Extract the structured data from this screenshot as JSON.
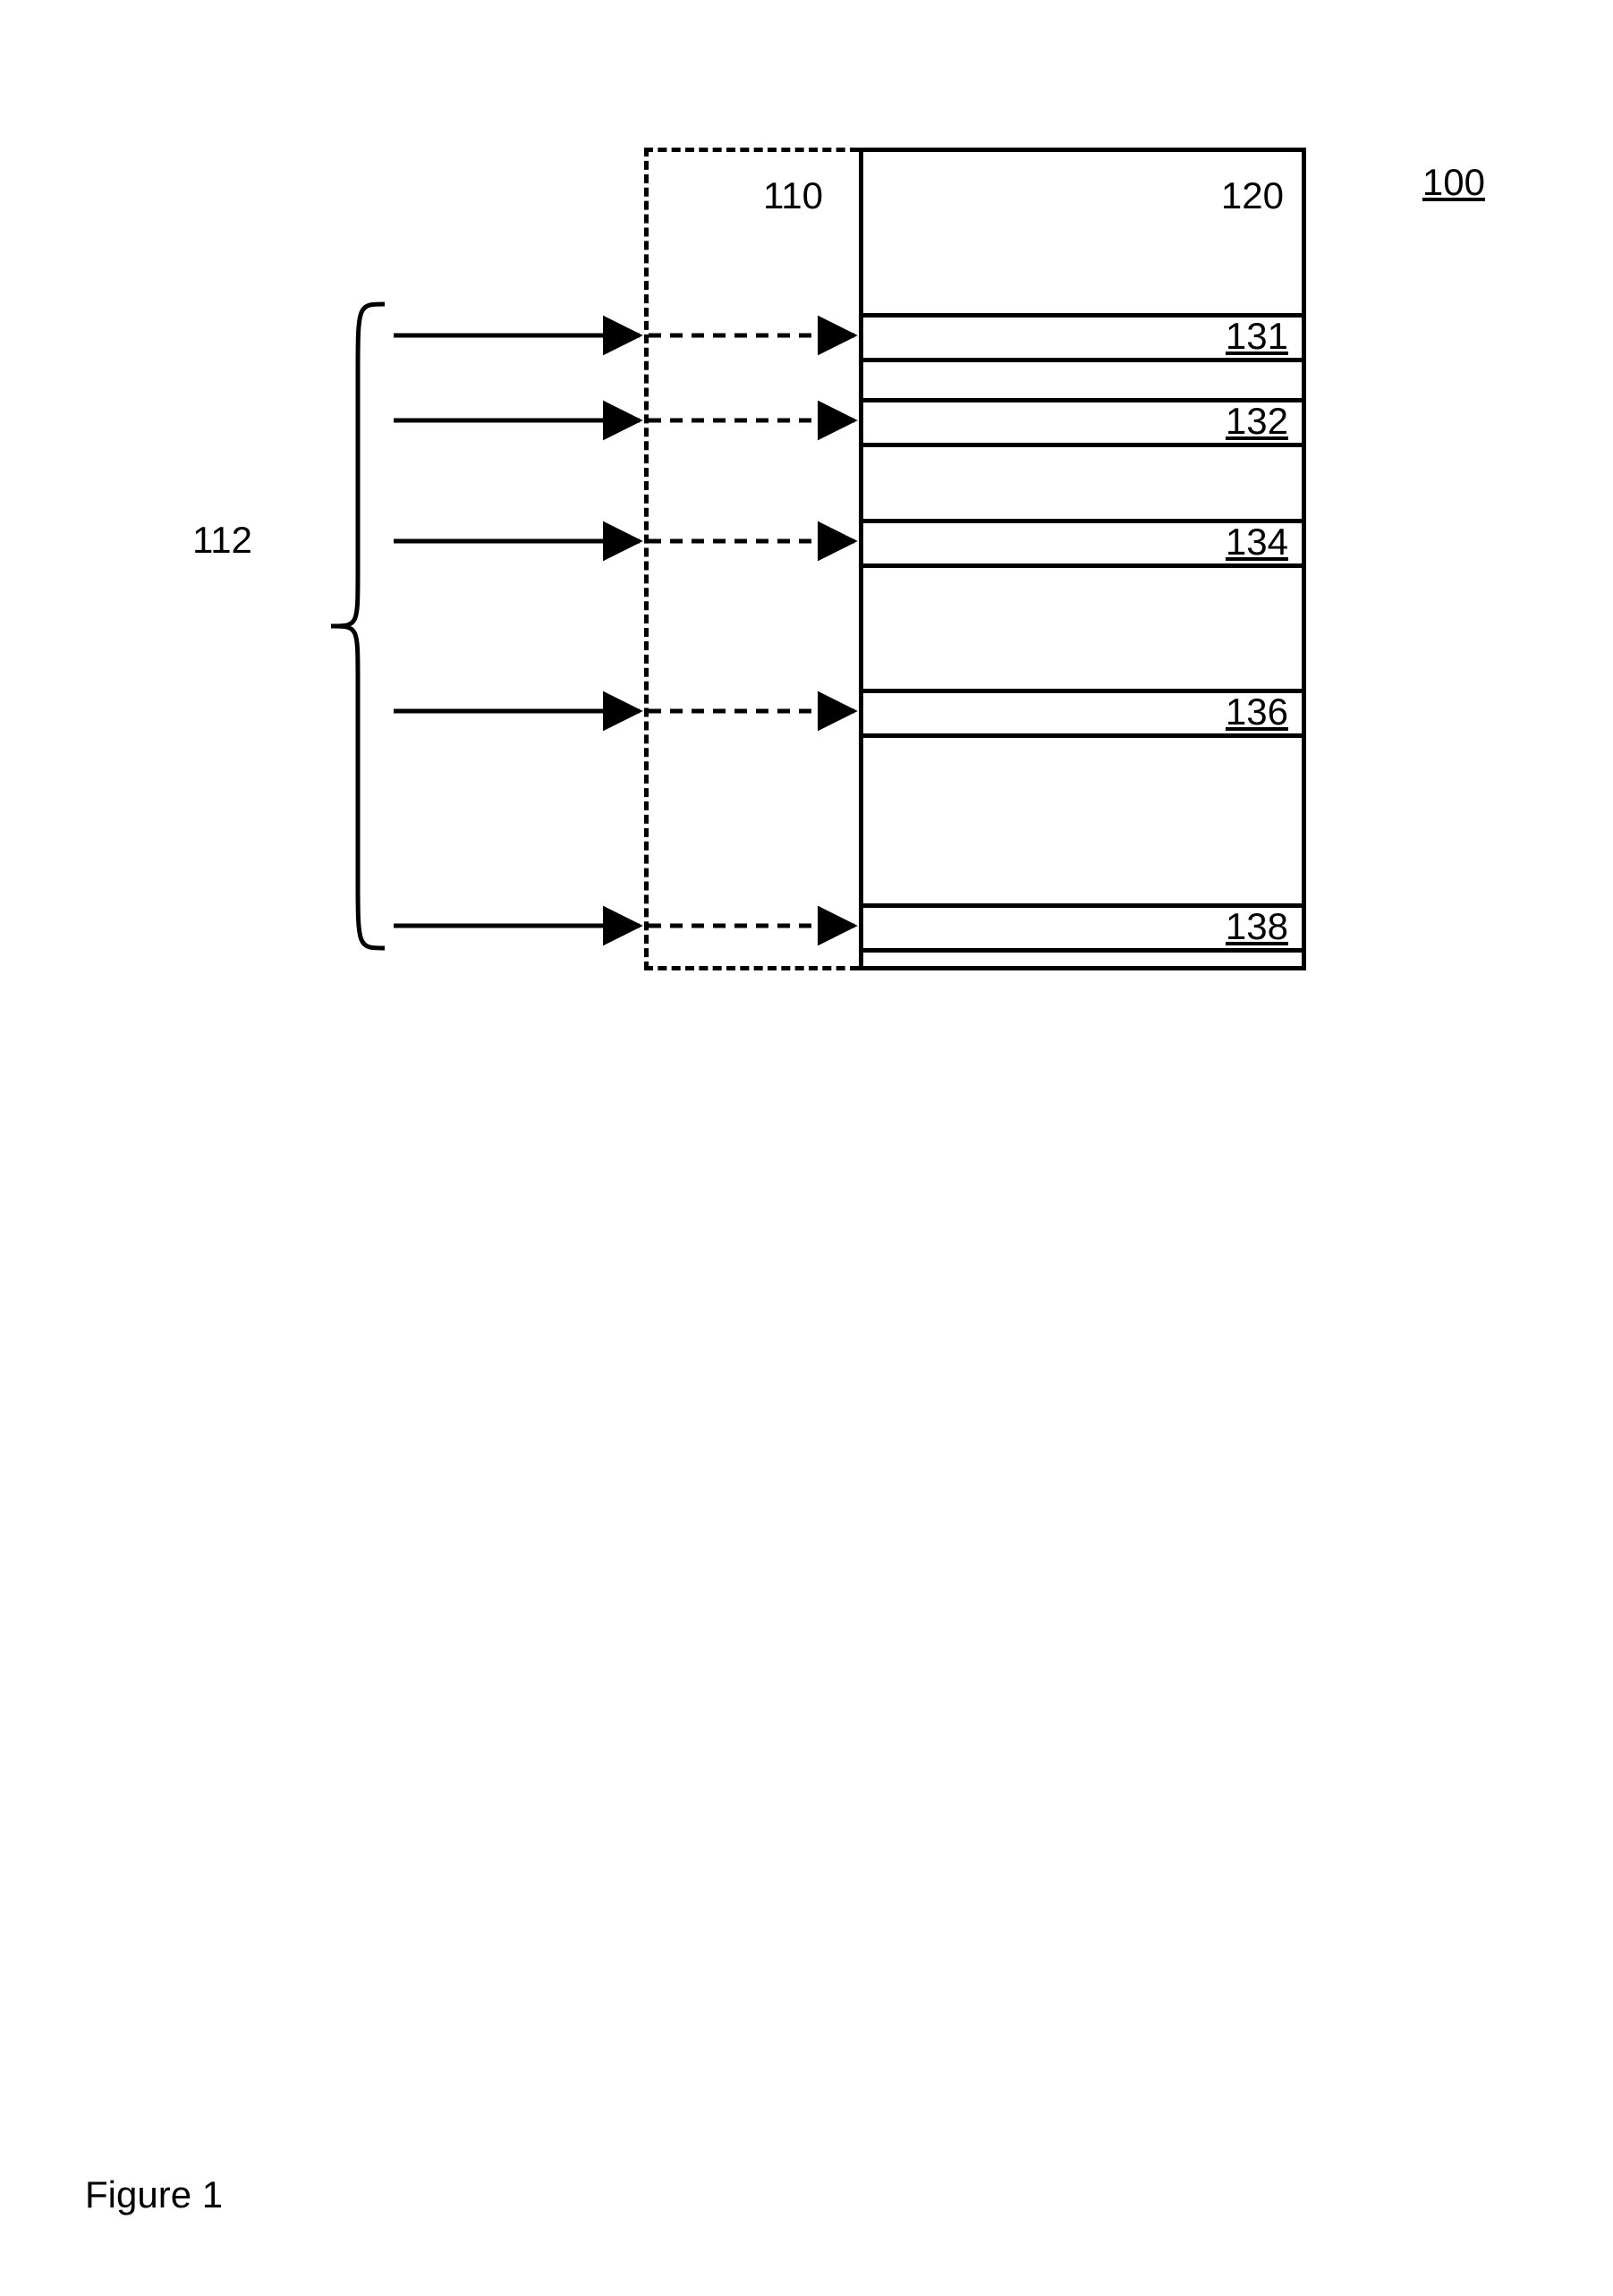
{
  "figure": {
    "caption": "Figure 1",
    "system_label": "100",
    "interface_label": "110",
    "module_label": "120",
    "inputs_group_label": "112",
    "row_labels": [
      "131",
      "132",
      "134",
      "136",
      "138"
    ]
  }
}
